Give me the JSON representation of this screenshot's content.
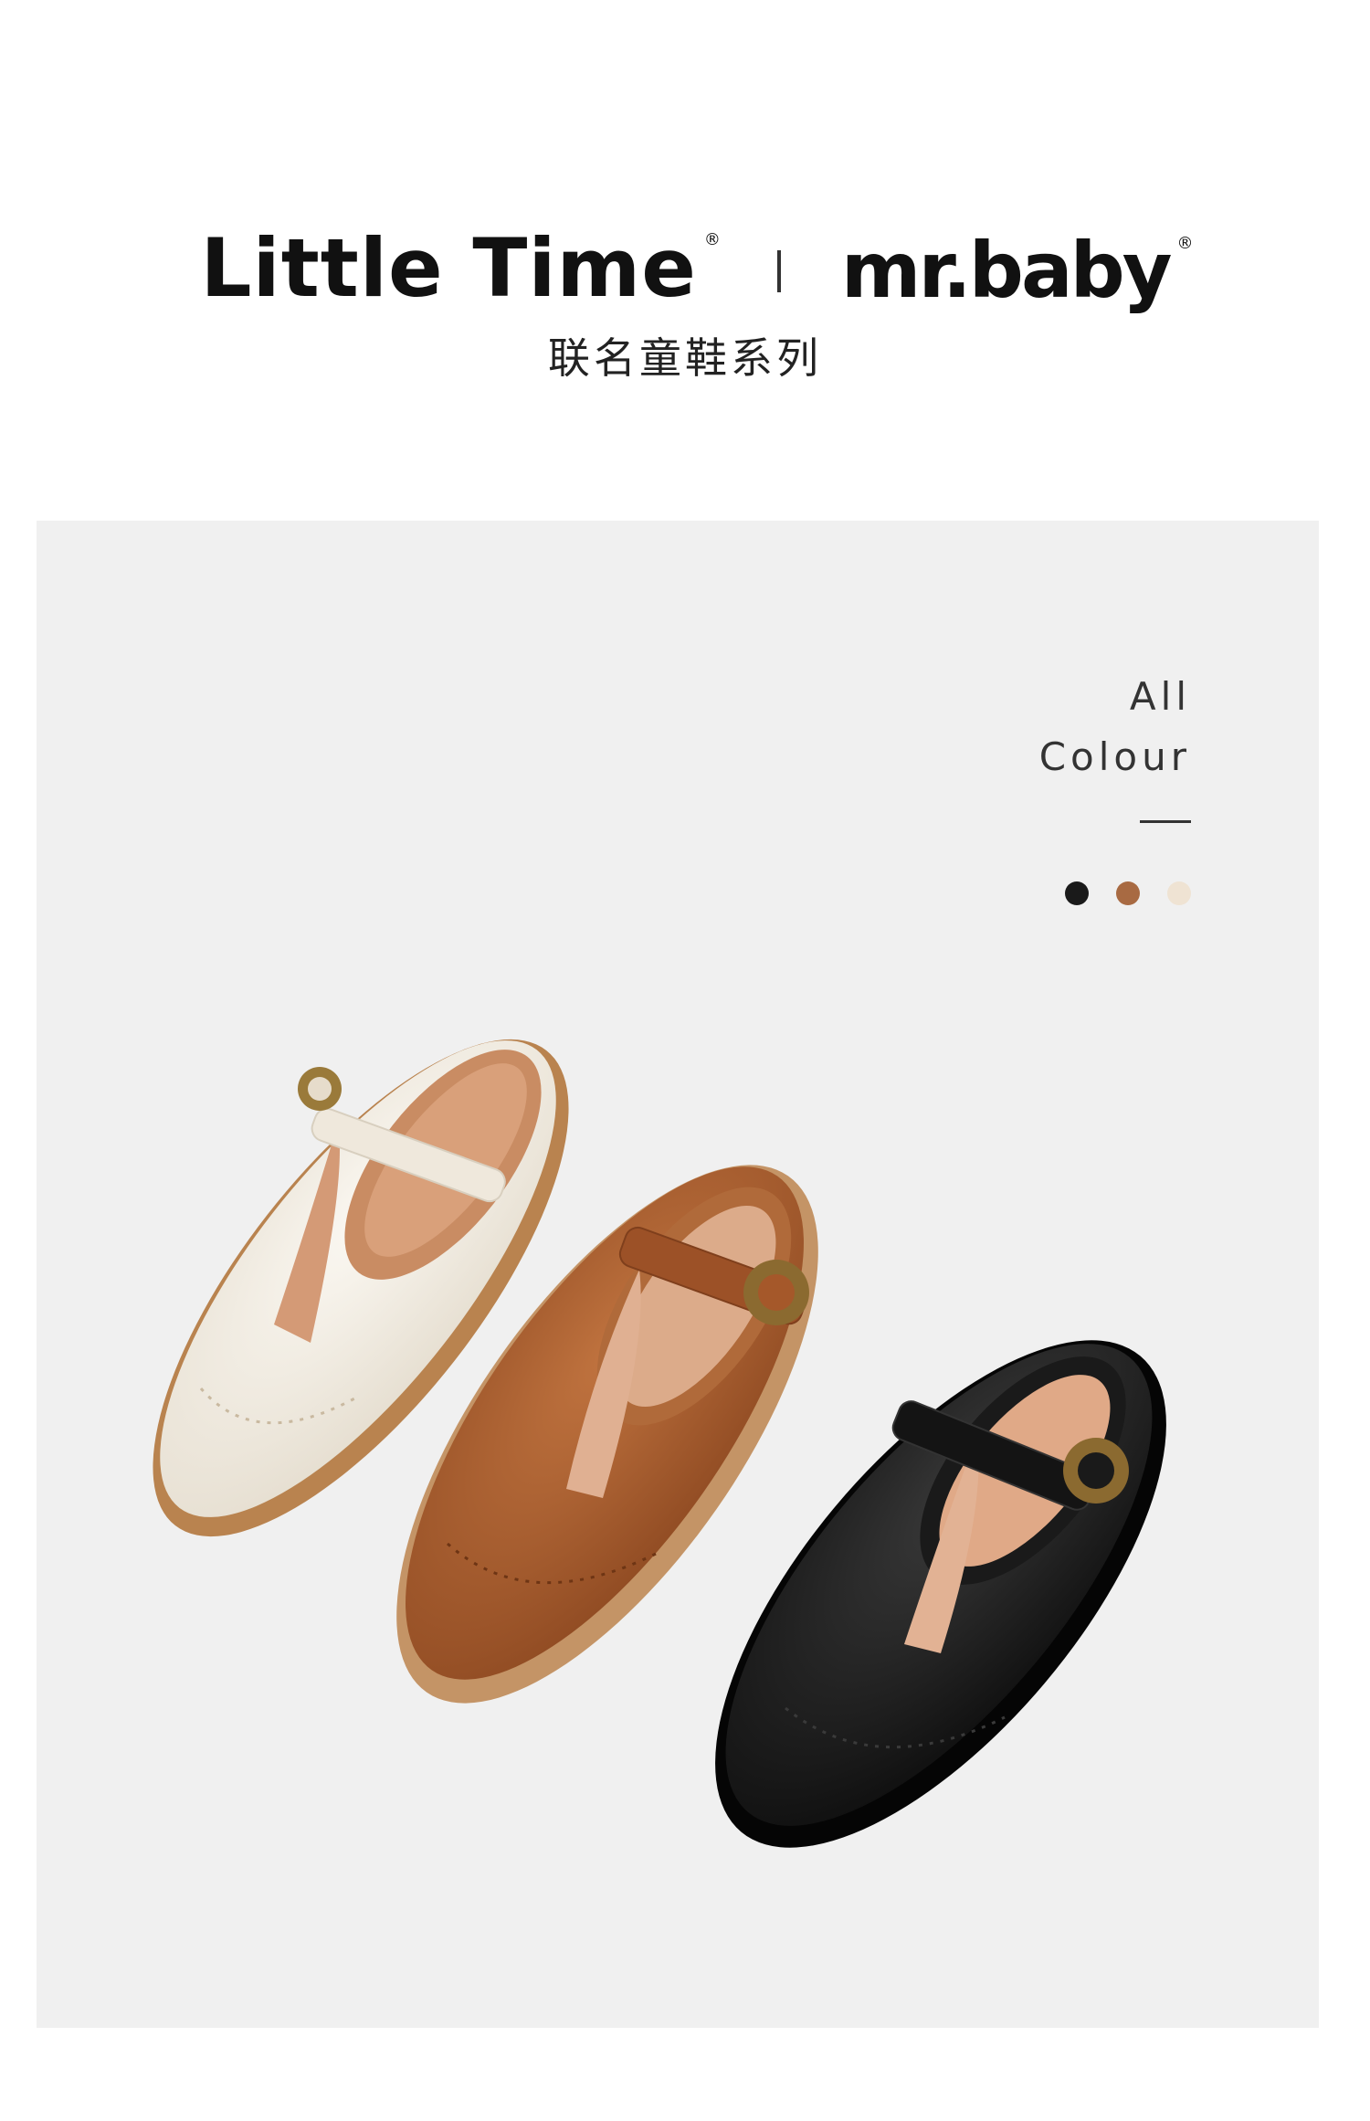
{
  "header": {
    "brand_left": "Little Time",
    "brand_right": "mr.baby",
    "registered_mark": "®",
    "subtitle": "联名童鞋系列"
  },
  "color_panel": {
    "line1": "All",
    "line2": "Colour",
    "swatches": [
      {
        "name": "black",
        "color": "#1a1a1a"
      },
      {
        "name": "brown",
        "color": "#a86a42"
      },
      {
        "name": "cream",
        "color": "#efe3d3"
      }
    ]
  },
  "products": [
    {
      "name": "cream-t-strap-shoe",
      "upper": "#f1ebe0",
      "sole": "#b07a48",
      "lining": "#c98c63"
    },
    {
      "name": "brown-t-strap-shoe",
      "upper": "#a5582a",
      "sole": "#c49466",
      "lining": "#d49a76"
    },
    {
      "name": "black-t-strap-shoe",
      "upper": "#161616",
      "sole": "#0a0a0a",
      "lining": "#d9a17e"
    }
  ]
}
